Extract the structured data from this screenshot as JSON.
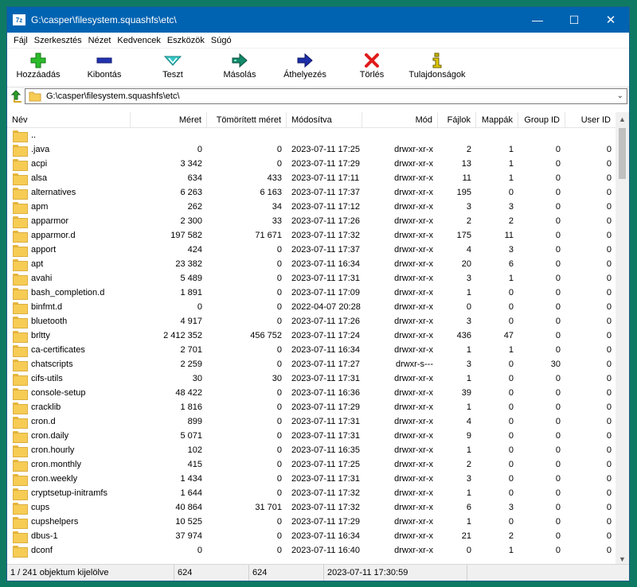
{
  "window": {
    "title": "G:\\casper\\filesystem.squashfs\\etc\\",
    "app_icon": "7z",
    "minimize": "—",
    "maximize": "☐",
    "close": "✕"
  },
  "menu": [
    "Fájl",
    "Szerkesztés",
    "Nézet",
    "Kedvencek",
    "Eszközök",
    "Súgó"
  ],
  "toolbar": [
    {
      "label": "Hozzáadás",
      "icon": "add-icon",
      "color": "#1fb31f"
    },
    {
      "label": "Kibontás",
      "icon": "extract-icon",
      "color": "#1e2ea8"
    },
    {
      "label": "Teszt",
      "icon": "test-icon",
      "color": "#2ab3b3"
    },
    {
      "label": "Másolás",
      "icon": "copy-icon",
      "color": "#0f8a6a"
    },
    {
      "label": "Áthelyezés",
      "icon": "move-icon",
      "color": "#1e2ea8"
    },
    {
      "label": "Törlés",
      "icon": "delete-icon",
      "color": "#e01b1b"
    },
    {
      "label": "Tulajdonságok",
      "icon": "info-icon",
      "color": "#b8a000"
    }
  ],
  "address": {
    "path": "G:\\casper\\filesystem.squashfs\\etc\\"
  },
  "columns": [
    "Név",
    "Méret",
    "Tömörített méret",
    "Módosítva",
    "Mód",
    "Fájlok",
    "Mappák",
    "Group ID",
    "User ID"
  ],
  "rows": [
    {
      "name": "..",
      "size": "",
      "packed": "",
      "modified": "",
      "mode": "",
      "files": "",
      "folders": "",
      "gid": "",
      "uid": ""
    },
    {
      "name": ".java",
      "size": "0",
      "packed": "0",
      "modified": "2023-07-11 17:25",
      "mode": "drwxr-xr-x",
      "files": "2",
      "folders": "1",
      "gid": "0",
      "uid": "0"
    },
    {
      "name": "acpi",
      "size": "3 342",
      "packed": "0",
      "modified": "2023-07-11 17:29",
      "mode": "drwxr-xr-x",
      "files": "13",
      "folders": "1",
      "gid": "0",
      "uid": "0"
    },
    {
      "name": "alsa",
      "size": "634",
      "packed": "433",
      "modified": "2023-07-11 17:11",
      "mode": "drwxr-xr-x",
      "files": "11",
      "folders": "1",
      "gid": "0",
      "uid": "0"
    },
    {
      "name": "alternatives",
      "size": "6 263",
      "packed": "6 163",
      "modified": "2023-07-11 17:37",
      "mode": "drwxr-xr-x",
      "files": "195",
      "folders": "0",
      "gid": "0",
      "uid": "0"
    },
    {
      "name": "apm",
      "size": "262",
      "packed": "34",
      "modified": "2023-07-11 17:12",
      "mode": "drwxr-xr-x",
      "files": "3",
      "folders": "3",
      "gid": "0",
      "uid": "0"
    },
    {
      "name": "apparmor",
      "size": "2 300",
      "packed": "33",
      "modified": "2023-07-11 17:26",
      "mode": "drwxr-xr-x",
      "files": "2",
      "folders": "2",
      "gid": "0",
      "uid": "0"
    },
    {
      "name": "apparmor.d",
      "size": "197 582",
      "packed": "71 671",
      "modified": "2023-07-11 17:32",
      "mode": "drwxr-xr-x",
      "files": "175",
      "folders": "11",
      "gid": "0",
      "uid": "0"
    },
    {
      "name": "apport",
      "size": "424",
      "packed": "0",
      "modified": "2023-07-11 17:37",
      "mode": "drwxr-xr-x",
      "files": "4",
      "folders": "3",
      "gid": "0",
      "uid": "0"
    },
    {
      "name": "apt",
      "size": "23 382",
      "packed": "0",
      "modified": "2023-07-11 16:34",
      "mode": "drwxr-xr-x",
      "files": "20",
      "folders": "6",
      "gid": "0",
      "uid": "0"
    },
    {
      "name": "avahi",
      "size": "5 489",
      "packed": "0",
      "modified": "2023-07-11 17:31",
      "mode": "drwxr-xr-x",
      "files": "3",
      "folders": "1",
      "gid": "0",
      "uid": "0"
    },
    {
      "name": "bash_completion.d",
      "size": "1 891",
      "packed": "0",
      "modified": "2023-07-11 17:09",
      "mode": "drwxr-xr-x",
      "files": "1",
      "folders": "0",
      "gid": "0",
      "uid": "0"
    },
    {
      "name": "binfmt.d",
      "size": "0",
      "packed": "0",
      "modified": "2022-04-07 20:28",
      "mode": "drwxr-xr-x",
      "files": "0",
      "folders": "0",
      "gid": "0",
      "uid": "0"
    },
    {
      "name": "bluetooth",
      "size": "4 917",
      "packed": "0",
      "modified": "2023-07-11 17:26",
      "mode": "drwxr-xr-x",
      "files": "3",
      "folders": "0",
      "gid": "0",
      "uid": "0"
    },
    {
      "name": "brltty",
      "size": "2 412 352",
      "packed": "456 752",
      "modified": "2023-07-11 17:24",
      "mode": "drwxr-xr-x",
      "files": "436",
      "folders": "47",
      "gid": "0",
      "uid": "0"
    },
    {
      "name": "ca-certificates",
      "size": "2 701",
      "packed": "0",
      "modified": "2023-07-11 16:34",
      "mode": "drwxr-xr-x",
      "files": "1",
      "folders": "1",
      "gid": "0",
      "uid": "0"
    },
    {
      "name": "chatscripts",
      "size": "2 259",
      "packed": "0",
      "modified": "2023-07-11 17:27",
      "mode": "drwxr-s---",
      "files": "3",
      "folders": "0",
      "gid": "30",
      "uid": "0"
    },
    {
      "name": "cifs-utils",
      "size": "30",
      "packed": "30",
      "modified": "2023-07-11 17:31",
      "mode": "drwxr-xr-x",
      "files": "1",
      "folders": "0",
      "gid": "0",
      "uid": "0"
    },
    {
      "name": "console-setup",
      "size": "48 422",
      "packed": "0",
      "modified": "2023-07-11 16:36",
      "mode": "drwxr-xr-x",
      "files": "39",
      "folders": "0",
      "gid": "0",
      "uid": "0"
    },
    {
      "name": "cracklib",
      "size": "1 816",
      "packed": "0",
      "modified": "2023-07-11 17:29",
      "mode": "drwxr-xr-x",
      "files": "1",
      "folders": "0",
      "gid": "0",
      "uid": "0"
    },
    {
      "name": "cron.d",
      "size": "899",
      "packed": "0",
      "modified": "2023-07-11 17:31",
      "mode": "drwxr-xr-x",
      "files": "4",
      "folders": "0",
      "gid": "0",
      "uid": "0"
    },
    {
      "name": "cron.daily",
      "size": "5 071",
      "packed": "0",
      "modified": "2023-07-11 17:31",
      "mode": "drwxr-xr-x",
      "files": "9",
      "folders": "0",
      "gid": "0",
      "uid": "0"
    },
    {
      "name": "cron.hourly",
      "size": "102",
      "packed": "0",
      "modified": "2023-07-11 16:35",
      "mode": "drwxr-xr-x",
      "files": "1",
      "folders": "0",
      "gid": "0",
      "uid": "0"
    },
    {
      "name": "cron.monthly",
      "size": "415",
      "packed": "0",
      "modified": "2023-07-11 17:25",
      "mode": "drwxr-xr-x",
      "files": "2",
      "folders": "0",
      "gid": "0",
      "uid": "0"
    },
    {
      "name": "cron.weekly",
      "size": "1 434",
      "packed": "0",
      "modified": "2023-07-11 17:31",
      "mode": "drwxr-xr-x",
      "files": "3",
      "folders": "0",
      "gid": "0",
      "uid": "0"
    },
    {
      "name": "cryptsetup-initramfs",
      "size": "1 644",
      "packed": "0",
      "modified": "2023-07-11 17:32",
      "mode": "drwxr-xr-x",
      "files": "1",
      "folders": "0",
      "gid": "0",
      "uid": "0"
    },
    {
      "name": "cups",
      "size": "40 864",
      "packed": "31 701",
      "modified": "2023-07-11 17:32",
      "mode": "drwxr-xr-x",
      "files": "6",
      "folders": "3",
      "gid": "0",
      "uid": "0"
    },
    {
      "name": "cupshelpers",
      "size": "10 525",
      "packed": "0",
      "modified": "2023-07-11 17:29",
      "mode": "drwxr-xr-x",
      "files": "1",
      "folders": "0",
      "gid": "0",
      "uid": "0"
    },
    {
      "name": "dbus-1",
      "size": "37 974",
      "packed": "0",
      "modified": "2023-07-11 16:34",
      "mode": "drwxr-xr-x",
      "files": "21",
      "folders": "2",
      "gid": "0",
      "uid": "0"
    },
    {
      "name": "dconf",
      "size": "0",
      "packed": "0",
      "modified": "2023-07-11 16:40",
      "mode": "drwxr-xr-x",
      "files": "0",
      "folders": "1",
      "gid": "0",
      "uid": "0"
    }
  ],
  "status": {
    "selection": "1 / 241 objektum kijelölve",
    "size": "624",
    "packed": "624",
    "modified": "2023-07-11 17:30:59"
  }
}
